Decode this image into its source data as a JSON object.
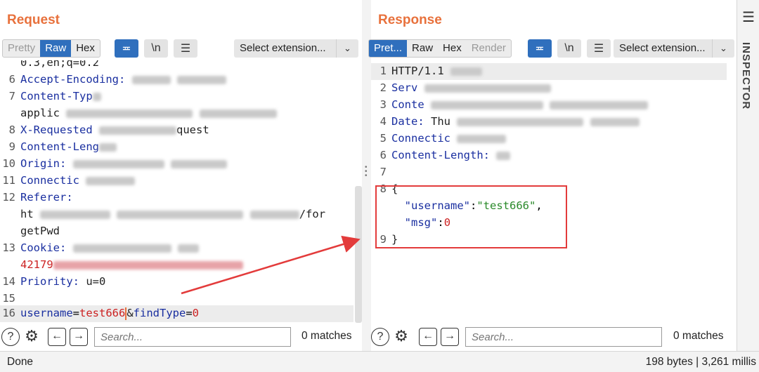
{
  "request": {
    "title": "Request",
    "tabs": [
      {
        "label": "Pretty",
        "state": "disabled"
      },
      {
        "label": "Raw",
        "state": "active"
      },
      {
        "label": "Hex",
        "state": "normal"
      }
    ],
    "newline_label": "\\n",
    "extension_label": "Select extension...",
    "lines": [
      {
        "n": "",
        "text": "0.3,en;q=0.2"
      },
      {
        "n": "6",
        "name": "Accept-Encoding:"
      },
      {
        "n": "7",
        "name": "Content-Typ"
      },
      {
        "n": "",
        "text": "applic"
      },
      {
        "n": "8",
        "name": "X-Requested",
        "tail": "quest"
      },
      {
        "n": "9",
        "name": "Content-Leng"
      },
      {
        "n": "10",
        "name": "Origin:"
      },
      {
        "n": "11",
        "name": "Connectic"
      },
      {
        "n": "12",
        "name": "Referer:"
      },
      {
        "n": "",
        "text": "ht",
        "tail": "/for"
      },
      {
        "n": "",
        "text": "getPwd"
      },
      {
        "n": "13",
        "name": "Cookie:"
      },
      {
        "n": "",
        "red": "42179"
      },
      {
        "n": "14",
        "name": "Priority:",
        "value": "u=0"
      },
      {
        "n": "15"
      },
      {
        "n": "16"
      }
    ],
    "body": {
      "key1": "username",
      "val1": "test666",
      "amp": "&",
      "key2": "findType",
      "val2": "0"
    },
    "search_placeholder": "Search...",
    "matches": "0 matches"
  },
  "response": {
    "title": "Response",
    "tabs": [
      {
        "label": "Pret...",
        "state": "active"
      },
      {
        "label": "Raw",
        "state": "normal"
      },
      {
        "label": "Hex",
        "state": "normal"
      },
      {
        "label": "Render",
        "state": "disabled"
      }
    ],
    "newline_label": "\\n",
    "extension_label": "Select extension...",
    "lines": [
      {
        "n": "1",
        "plain": "HTTP/1.1"
      },
      {
        "n": "2",
        "name": "Serv"
      },
      {
        "n": "3",
        "name": "Conte"
      },
      {
        "n": "4",
        "name": "Date:",
        "value": "Thu"
      },
      {
        "n": "5",
        "name": "Connectic"
      },
      {
        "n": "6",
        "name": "Content-Length:"
      },
      {
        "n": "7"
      },
      {
        "n": "8",
        "plain": "{"
      }
    ],
    "json": {
      "key1": "\"username\"",
      "val1": "\"test666\"",
      "key2": "\"msg\"",
      "val2": "0",
      "close": "}",
      "close_n": "9"
    },
    "search_placeholder": "Search...",
    "matches": "0 matches"
  },
  "inspector": {
    "label": "INSPECTOR"
  },
  "status": {
    "left": "Done",
    "right": "198 bytes | 3,261 millis"
  },
  "colors": {
    "accent": "#e8713c",
    "active_tab": "#2f6fbd",
    "annotation": "#e33b3b"
  }
}
